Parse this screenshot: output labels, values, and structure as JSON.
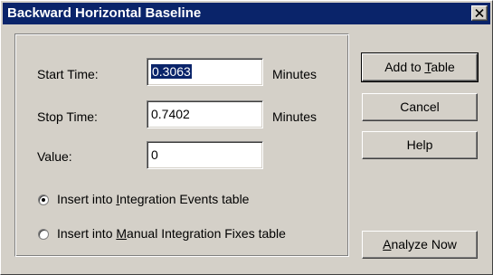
{
  "window": {
    "title": "Backward Horizontal Baseline",
    "close_icon": "close-icon"
  },
  "form": {
    "start_time": {
      "label": "Start Time:",
      "value": "0.3063",
      "unit": "Minutes"
    },
    "stop_time": {
      "label": "Stop Time:",
      "value": "0.7402",
      "unit": "Minutes"
    },
    "value": {
      "label": "Value:",
      "value": "0"
    }
  },
  "options": {
    "integration_events": {
      "pre": "Insert into ",
      "accel": "I",
      "post": "ntegration Events table",
      "selected": true
    },
    "manual_fixes": {
      "pre": "Insert into ",
      "accel": "M",
      "post": "anual Integration Fixes table",
      "selected": false
    }
  },
  "buttons": {
    "add_to_table": {
      "pre": "Add to ",
      "accel": "T",
      "post": "able"
    },
    "cancel": {
      "label": "Cancel"
    },
    "help": {
      "label": "Help"
    },
    "analyze_now": {
      "pre": "",
      "accel": "A",
      "post": "nalyze Now"
    }
  },
  "colors": {
    "titlebar": "#0a246a",
    "dialog_face": "#d4d0c8",
    "selection": "#0a246a"
  }
}
